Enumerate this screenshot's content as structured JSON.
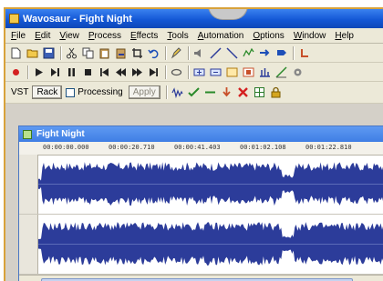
{
  "window": {
    "title": "Wavosaur - Fight Night"
  },
  "menu": [
    "File",
    "Edit",
    "View",
    "Process",
    "Effects",
    "Tools",
    "Automation",
    "Options",
    "Window",
    "Help"
  ],
  "toolbar_row1_icons": [
    "new-file-icon",
    "open-folder-icon",
    "save-icon",
    "cut-icon",
    "copy-icon",
    "paste-icon",
    "mix-paste-icon",
    "crop-icon",
    "undo-icon",
    "pen-icon",
    "speaker-icon",
    "fade-in-icon",
    "fade-out-icon",
    "envelope-icon",
    "loop-icon",
    "marker-icon",
    "edit-icon"
  ],
  "toolbar_row2_icons": [
    "record-icon",
    "play-icon",
    "play-loop-icon",
    "pause-icon",
    "stop-icon",
    "go-start-icon",
    "rewind-icon",
    "fast-forward-icon",
    "go-end-icon",
    "loop-toggle-icon",
    "zoom-in-icon",
    "zoom-out-icon",
    "zoom-fit-icon",
    "zoom-selection-icon",
    "normalize-icon",
    "spectrum-icon",
    "settings-icon"
  ],
  "vst": {
    "label": "VST",
    "rack_button": "Rack",
    "processing_label": "Processing",
    "apply_button": "Apply"
  },
  "toolbar_row3_icons": [
    "waveform-icon",
    "check-icon",
    "line-icon",
    "arrow-down-icon",
    "delete-x-icon",
    "grid-icon",
    "lock-icon"
  ],
  "document": {
    "title": "Fight Night",
    "ruler_labels": [
      "00:00:00.000",
      "00:00:20.710",
      "00:00:41.403",
      "00:01:02.108",
      "00:01:22.810"
    ]
  },
  "colors": {
    "accent": "#1458d6",
    "waveform": "#2c3c9a",
    "frame": "#d8a23a"
  }
}
